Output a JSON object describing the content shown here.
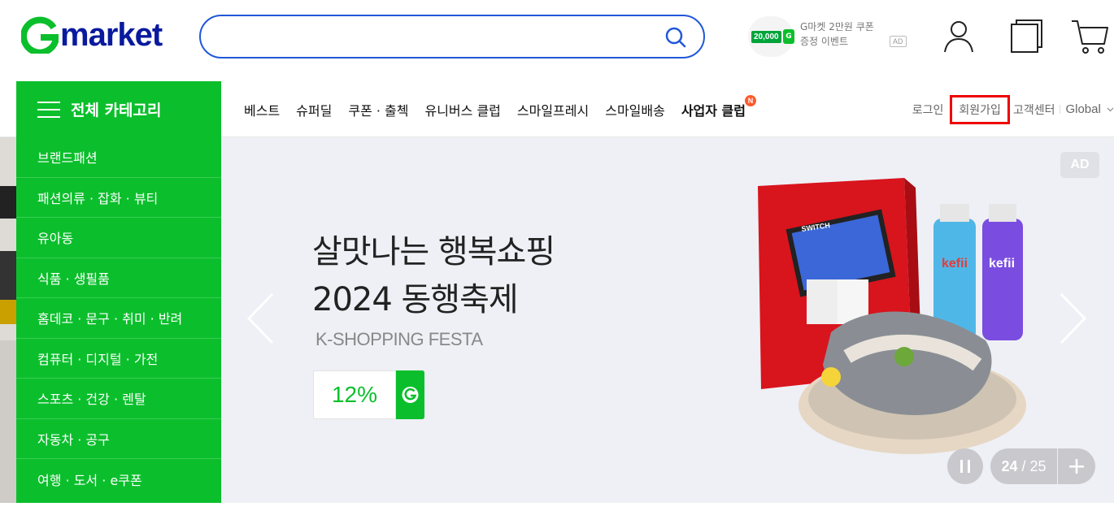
{
  "header": {
    "logo": {
      "g": "G",
      "text": "market"
    },
    "search": {
      "value": "",
      "placeholder": ""
    },
    "promo": {
      "amount": "20,000",
      "g_badge": "G",
      "line1": "G마켓 2만원 쿠폰",
      "line2": "증정 이벤트",
      "ad": "AD"
    },
    "icons": [
      "user-icon",
      "recent-items-icon",
      "cart-icon"
    ]
  },
  "nav": {
    "category_label": "전체 카테고리",
    "links": [
      {
        "label": "베스트",
        "bold": false
      },
      {
        "label": "슈퍼딜",
        "bold": false
      },
      {
        "label": "쿠폰 · 출첵",
        "bold": false
      },
      {
        "label": "유니버스 클럽",
        "bold": false
      },
      {
        "label": "스마일프레시",
        "bold": false
      },
      {
        "label": "스마일배송",
        "bold": false
      },
      {
        "label": "사업자 클럽",
        "bold": true,
        "badge": "N"
      }
    ],
    "util": {
      "login": "로그인",
      "signup": "회원가입",
      "customer_center": "고객센터",
      "global": "Global"
    }
  },
  "sidebar": {
    "items": [
      "브랜드패션",
      "패션의류 · 잡화 · 뷰티",
      "유아동",
      "식품 · 생필품",
      "홈데코 · 문구 · 취미 · 반려",
      "컴퓨터 · 디지털 · 가전",
      "스포츠 · 건강 · 렌탈",
      "자동차 · 공구",
      "여행 · 도서 · e쿠폰"
    ]
  },
  "banner": {
    "line1": "살맛나는 행복쇼핑",
    "line2": "2024 동행축제",
    "subtitle": "K-SHOPPING FESTA",
    "discount": "12%",
    "ad": "AD",
    "current_slide": "24",
    "separator": " / ",
    "total_slides": "25",
    "product_labels": {
      "switch": "SWITCH",
      "kefii1": "kefii",
      "kefii2": "kefii"
    }
  },
  "colors": {
    "brand_green": "#0bbf2c",
    "logo_blue": "#0a1a9e",
    "search_border": "#2157d8",
    "highlight_red": "#e00000"
  }
}
